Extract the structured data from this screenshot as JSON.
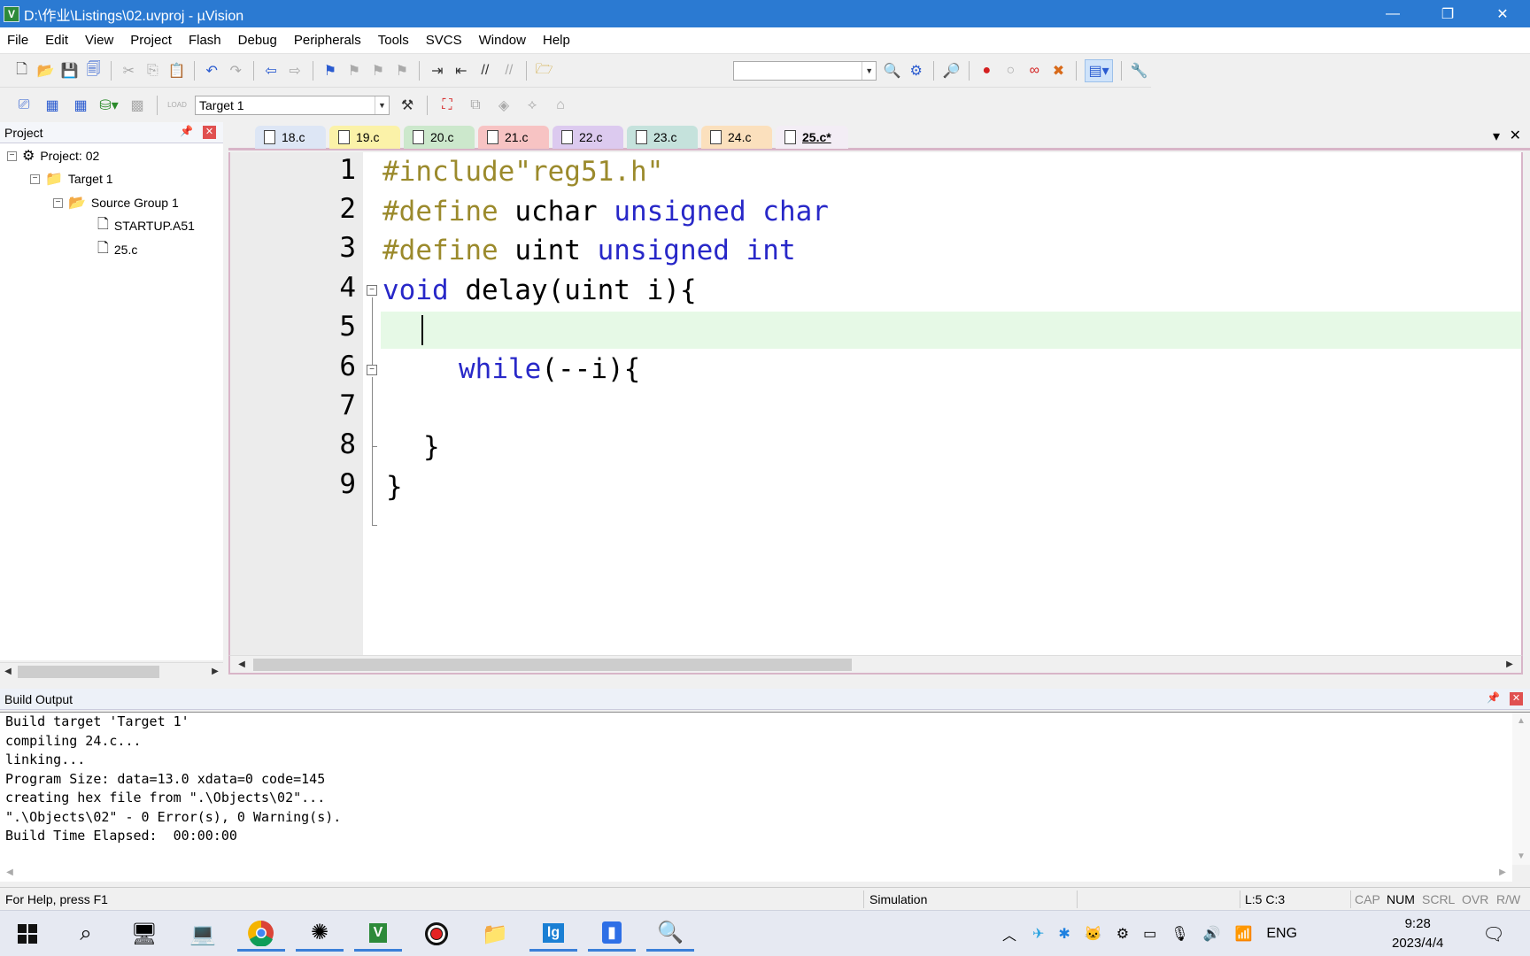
{
  "title": "D:\\作业\\Listings\\02.uvproj - µVision",
  "window_controls": {
    "minimize": "—",
    "restore": "❐",
    "close": "✕"
  },
  "menu": [
    "File",
    "Edit",
    "View",
    "Project",
    "Flash",
    "Debug",
    "Peripherals",
    "Tools",
    "SVCS",
    "Window",
    "Help"
  ],
  "toolbar": {
    "target": "Target 1",
    "load": "LOAD"
  },
  "project_panel": {
    "title": "Project",
    "pin": "📌",
    "close": "✕",
    "tree": {
      "project": "Project: 02",
      "target": "Target 1",
      "group": "Source Group 1",
      "files": [
        "STARTUP.A51",
        "25.c"
      ]
    }
  },
  "tabs": [
    "18.c",
    "19.c",
    "20.c",
    "21.c",
    "22.c",
    "23.c",
    "24.c",
    "25.c*"
  ],
  "tab_colors": [
    "#dde6f5",
    "#fbf2a8",
    "#cce8cc",
    "#f7c3c3",
    "#dccaef",
    "#c5e2dc",
    "#fbe0bd",
    "#f3edf5"
  ],
  "tab_menu": "▾",
  "tab_close": "✕",
  "line_numbers": [
    "1",
    "2",
    "3",
    "4",
    "5",
    "6",
    "7",
    "8",
    "9"
  ],
  "code": {
    "l1": "#include\"reg51.h\"",
    "l2a": "#define",
    "l2b": " uchar ",
    "l2c": "unsigned char",
    "l3a": "#define",
    "l3b": " uint ",
    "l3c": "unsigned int",
    "l4a": "void",
    "l4b": " delay(uint i){",
    "l6a": "while",
    "l6b": "(--i){",
    "l8": "}",
    "l9": "}"
  },
  "fold_marks": {
    "l4": "−",
    "l6": "−"
  },
  "build_output": {
    "title": "Build Output",
    "pin": "📌",
    "close": "✕",
    "lines": [
      "Build target 'Target 1'",
      "compiling 24.c...",
      "linking...",
      "Program Size: data=13.0 xdata=0 code=145",
      "creating hex file from \".\\Objects\\02\"...",
      "\".\\Objects\\02\" - 0 Error(s), 0 Warning(s).",
      "Build Time Elapsed:  00:00:00"
    ]
  },
  "status": {
    "help": "For Help, press F1",
    "mode": "Simulation",
    "pos": "L:5 C:3",
    "cap": "CAP",
    "num": "NUM",
    "scrl": "SCRL",
    "ovr": "OVR",
    "rw": "R/W"
  },
  "taskbar": {
    "lang": "ENG",
    "time": "9:28",
    "date": "2023/4/4"
  },
  "arrows": {
    "left": "◀",
    "right": "▶",
    "up": "▲",
    "down": "▼"
  }
}
